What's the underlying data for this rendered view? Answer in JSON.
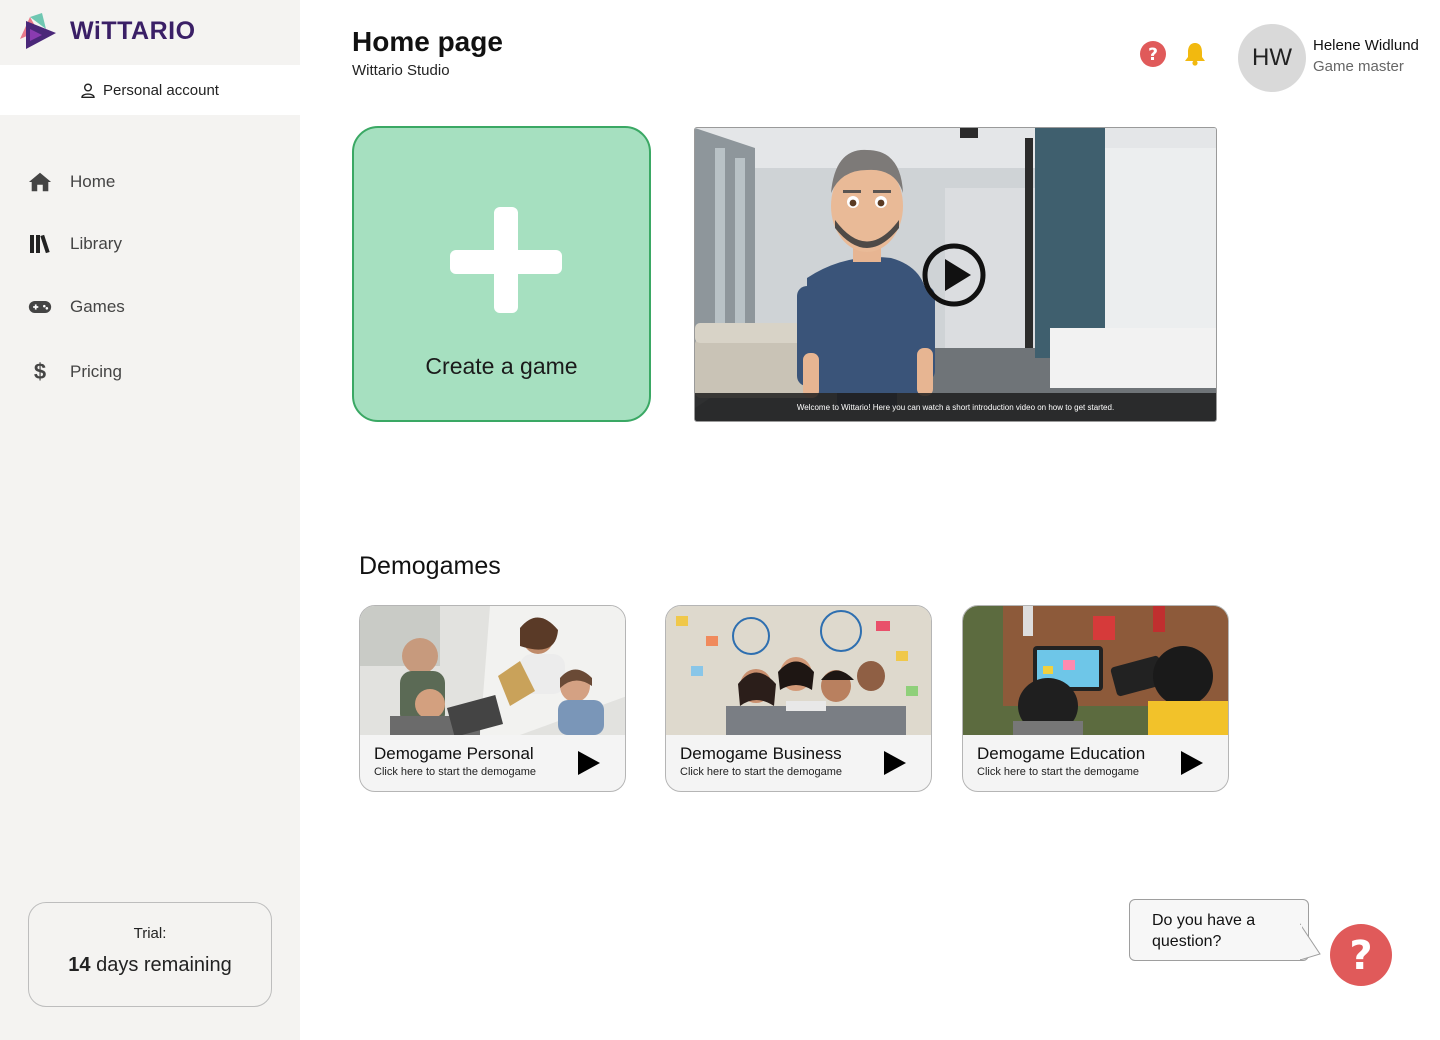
{
  "app": {
    "logo_text": "WiTTARIO"
  },
  "sidebar": {
    "account_label": "Personal account",
    "items": [
      {
        "label": "Home",
        "icon": "home-icon"
      },
      {
        "label": "Library",
        "icon": "library-icon"
      },
      {
        "label": "Games",
        "icon": "gamepad-icon"
      },
      {
        "label": "Pricing",
        "icon": "dollar-icon"
      }
    ],
    "trial": {
      "label": "Trial:",
      "days": "14",
      "days_suffix": "days remaining"
    }
  },
  "header": {
    "title": "Home page",
    "subtitle": "Wittario Studio",
    "user": {
      "initials": "HW",
      "name": "Helene Widlund",
      "role": "Game master"
    }
  },
  "main": {
    "create_label": "Create a game",
    "video_caption": "Welcome to Wittario! Here you can watch a short introduction video on how to get started.",
    "demogames_title": "Demogames",
    "demogames": [
      {
        "name": "Demogame Personal",
        "hint": "Click here to start the demogame"
      },
      {
        "name": "Demogame Business",
        "hint": "Click here to start the demogame"
      },
      {
        "name": "Demogame Education",
        "hint": "Click here to start the demogame"
      }
    ]
  },
  "help": {
    "question": "Do you have a question?"
  },
  "colors": {
    "accent_green": "#a6e0c0",
    "green_border": "#3aa864",
    "help_red": "#e05a5a",
    "bell_yellow": "#f2b90f",
    "brand_purple": "#3a1f66"
  }
}
